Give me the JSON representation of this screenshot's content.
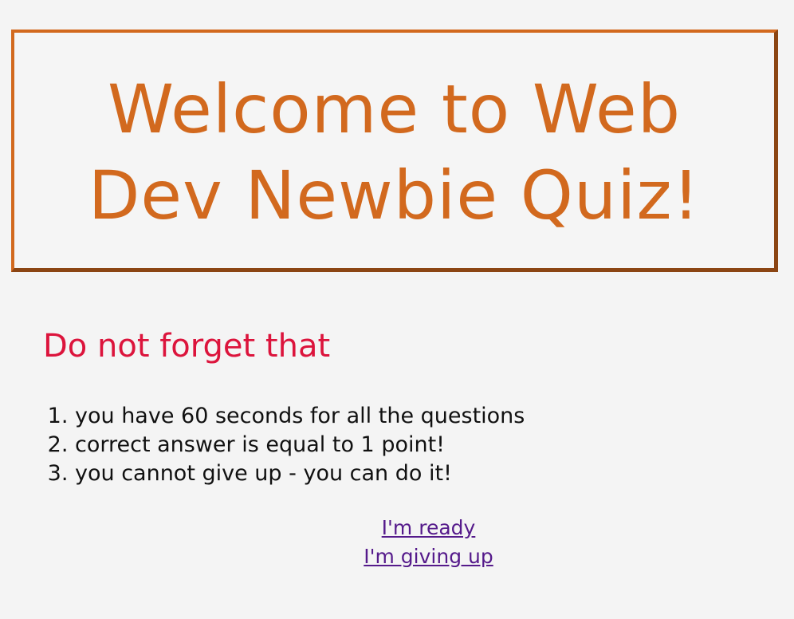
{
  "header": {
    "title": "Welcome to Web Dev Newbie Quiz!"
  },
  "reminder": {
    "heading": "Do not forget that",
    "rules": [
      "you have 60 seconds for all the questions",
      "correct answer is equal to 1 point!",
      "you cannot give up - you can do it!"
    ]
  },
  "actions": {
    "ready_label": "I'm ready",
    "give_up_label": "I'm giving up"
  },
  "colors": {
    "title": "#d2691e",
    "frame_dark": "#8b4513",
    "heading": "#dc143c",
    "link": "#551a8b",
    "background": "#f4f4f4"
  }
}
